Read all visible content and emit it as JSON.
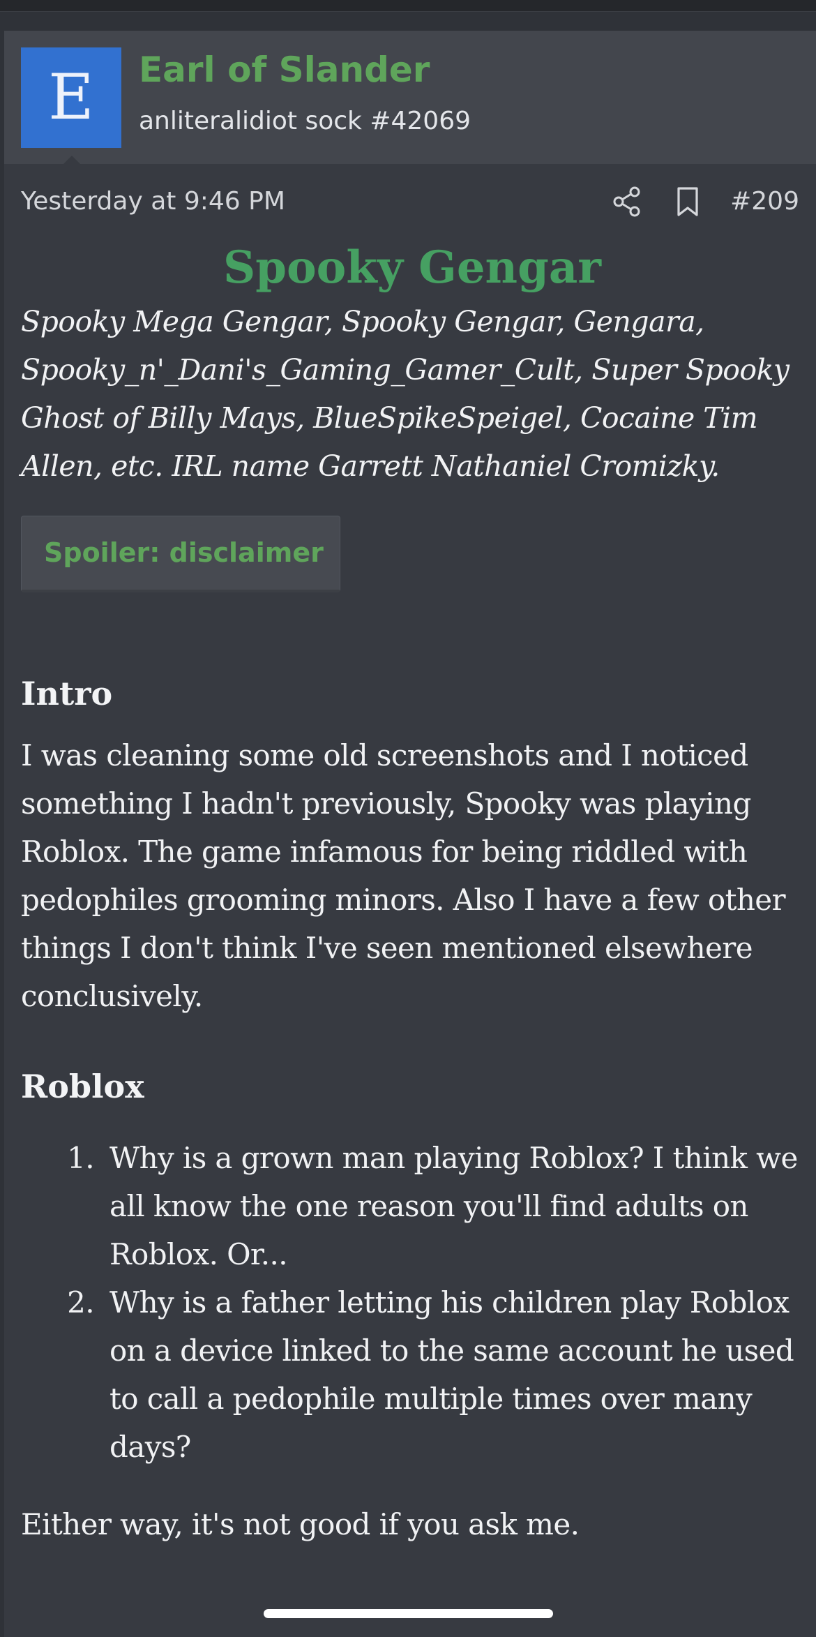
{
  "post": {
    "avatar_letter": "E",
    "username": "Earl of Slander",
    "user_title": "anliteralidiot sock #42069",
    "timestamp": "Yesterday at 9:46 PM",
    "post_number": "#209",
    "title": "Spooky Gengar",
    "aliases": "Spooky Mega Gengar, Spooky Gengar, Gengara, Spooky_n'_Dani's_Gaming_Gamer_Cult, Super Spooky Ghost of Billy Mays, BlueSpikeSpeigel, Cocaine Tim Allen, etc. IRL name Garrett Nathaniel Cromizky.",
    "spoiler_label": "Spoiler: disclaimer",
    "sections": {
      "intro_heading": "Intro",
      "intro_text": "I was cleaning some old screenshots and I noticed something I hadn't previously, Spooky was playing Roblox. The game infamous for being riddled with pedophiles grooming minors. Also I have a few other things I don't think I've seen mentioned elsewhere conclusively.",
      "roblox_heading": "Roblox",
      "roblox_list": [
        {
          "num": "1.",
          "text": "Why is a grown man playing Roblox? I think we all know the one reason you'll find adults on Roblox. Or..."
        },
        {
          "num": "2.",
          "text": "Why is a father letting his children play Roblox on a device linked to the same account he used to call a pedophile multiple times over many days?"
        }
      ],
      "cut_off_text": "Either way, it's not good if you ask me."
    }
  },
  "icons": {
    "share": "share-icon",
    "bookmark": "bookmark-icon"
  },
  "colors": {
    "accent_green": "#5fa55b",
    "title_green": "#46a062",
    "avatar_blue": "#3271d0",
    "background": "#373a41"
  }
}
